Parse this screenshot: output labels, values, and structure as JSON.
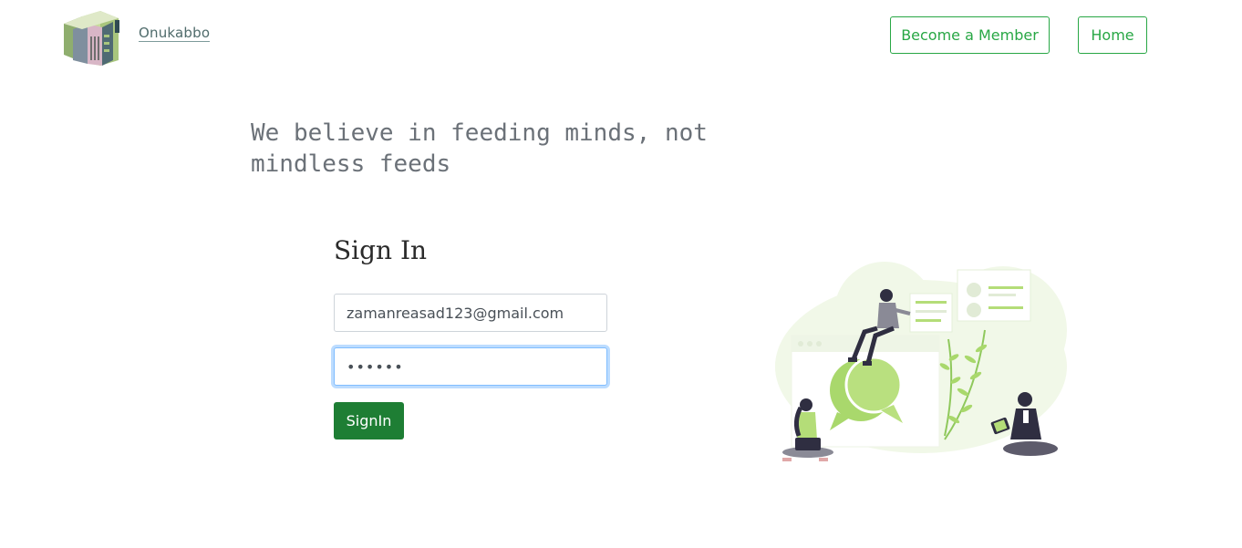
{
  "header": {
    "brand": "Onukabbo",
    "nav": {
      "become_member": "Become a Member",
      "home": "Home"
    }
  },
  "hero": {
    "tagline": "We believe in feeding minds, not mindless feeds"
  },
  "signin": {
    "title": "Sign In",
    "email_value": "zamanreasad123@gmail.com",
    "password_value": "••••••",
    "submit_label": "SignIn"
  },
  "colors": {
    "accent": "#28a745",
    "primary_button": "#1e7e34",
    "illustration_green": "#b4dd78"
  }
}
